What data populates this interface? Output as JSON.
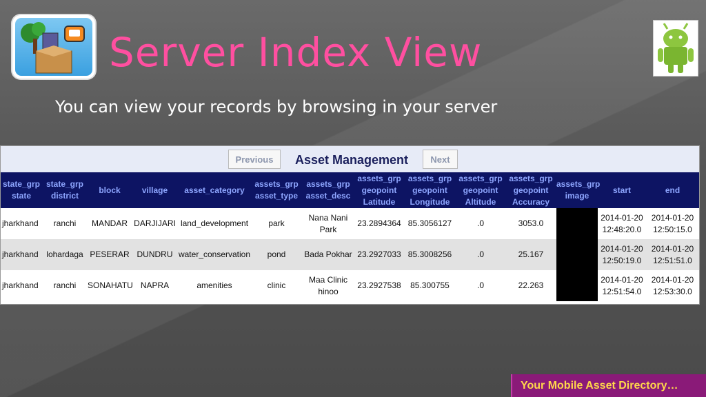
{
  "slide": {
    "title": "Server Index View",
    "subtitle": "You can view your records by browsing in your server",
    "footer": "Your Mobile Asset Directory…"
  },
  "panel": {
    "title": "Asset Management",
    "prev_label": "Previous",
    "next_label": "Next"
  },
  "table": {
    "headers": [
      [
        "state_grp",
        "state"
      ],
      [
        "state_grp",
        "district"
      ],
      [
        "block"
      ],
      [
        "village"
      ],
      [
        "asset_category"
      ],
      [
        "assets_grp",
        "asset_type"
      ],
      [
        "assets_grp",
        "asset_desc"
      ],
      [
        "assets_grp",
        "geopoint",
        "Latitude"
      ],
      [
        "assets_grp",
        "geopoint",
        "Longitude"
      ],
      [
        "assets_grp",
        "geopoint",
        "Altitude"
      ],
      [
        "assets_grp",
        "geopoint",
        "Accuracy"
      ],
      [
        "assets_grp",
        "image"
      ],
      [
        "start"
      ],
      [
        "end"
      ]
    ],
    "rows": [
      [
        "jharkhand",
        "ranchi",
        "MANDAR",
        "DARJIJARI",
        "land_development",
        "park",
        "Nana Nani Park",
        "23.2894364",
        "85.3056127",
        ".0",
        "3053.0",
        "",
        "2014-01-20 12:48:20.0",
        "2014-01-20 12:50:15.0"
      ],
      [
        "jharkhand",
        "lohardaga",
        "PESERAR",
        "DUNDRU",
        "water_conservation",
        "pond",
        "Bada Pokhar",
        "23.2927033",
        "85.3008256",
        ".0",
        "25.167",
        "",
        "2014-01-20 12:50:19.0",
        "2014-01-20 12:51:51.0"
      ],
      [
        "jharkhand",
        "ranchi",
        "SONAHATU",
        "NAPRA",
        "amenities",
        "clinic",
        "Maa Clinic hinoo",
        "23.2927538",
        "85.300755",
        ".0",
        "22.263",
        "",
        "2014-01-20 12:51:54.0",
        "2014-01-20 12:53:30.0"
      ]
    ]
  },
  "icons": {
    "logo": "asset-directory-logo-icon",
    "android": "android-robot-icon"
  },
  "colors": {
    "title": "#ff4fa0",
    "header_bg": "#0d1463",
    "header_text": "#8ea6ff",
    "footer_bg": "#8a1a78",
    "footer_text": "#ffd84a"
  }
}
